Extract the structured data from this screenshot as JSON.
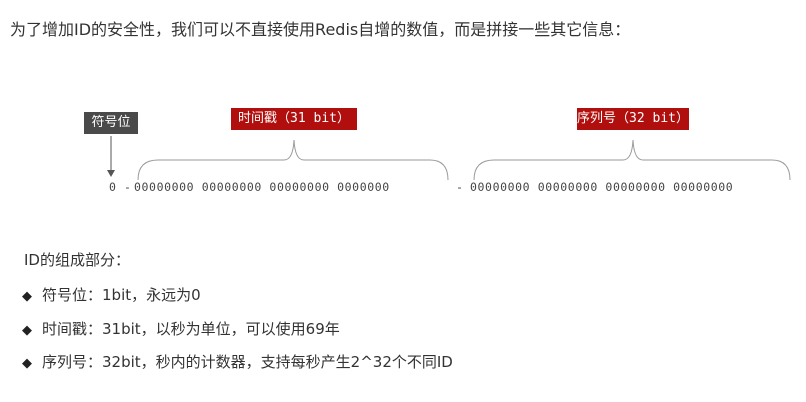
{
  "intro": "为了增加ID的安全性，我们可以不直接使用Redis自增的数值，而是拼接一些其它信息：",
  "labels": {
    "sign": "符号位",
    "timestamp_cn": "时间戳",
    "timestamp_bits": "（31 bit）",
    "sequence_cn": "序列号",
    "sequence_bits": "（32 bit）"
  },
  "bits": {
    "sign": "0",
    "dash1": "-",
    "timestamp": "00000000 00000000 00000000 0000000",
    "dash2": "-",
    "sequence": "00000000 00000000 00000000 00000000"
  },
  "parts": {
    "title": "ID的组成部分：",
    "items": [
      "符号位：1bit，永远为0",
      "时间戳：31bit，以秒为单位，可以使用69年",
      "序列号：32bit，秒内的计数器，支持每秒产生2^32个不同ID"
    ]
  },
  "colors": {
    "accent": "#b10e0e",
    "sign_box": "#4a4a4a",
    "brace": "#999999"
  }
}
